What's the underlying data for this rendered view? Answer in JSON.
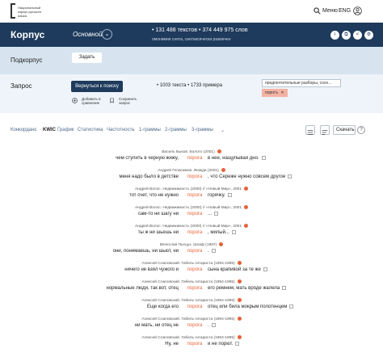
{
  "header": {
    "logo_text": "Национальный корпус русского языка",
    "menu_label": "Меню",
    "lang_label": "ENG"
  },
  "corpus": {
    "title": "Корпус",
    "selected": "Основной",
    "stats": "•  131 488 текстов  •  374 449 975 слов",
    "subtitle": "омонимия снята, синтаксически размечен"
  },
  "subcorpus": {
    "title": "Подкорпус",
    "set_label": "Задать"
  },
  "query": {
    "title": "Запрос",
    "return_label": "Вернуться к поиску",
    "stats": "•  1003 текста  •  1733 примера",
    "add_compare": "Добавить в сравнение",
    "save_query": "Сохранить запрос",
    "tag1": "предпочтительные разборы, сосе...",
    "tag2": "порогъ"
  },
  "tabs": {
    "items": [
      "Конкорданс",
      "KWIC",
      "График",
      "Статистика",
      "Частотность",
      "1-граммы",
      "2-граммы",
      "3-граммы"
    ],
    "active": "KWIC",
    "download_label": "Скачать",
    "help_label": "?"
  },
  "results": [
    {
      "source": "Василь Быков. Болото (2001)",
      "left": "чем ступить в черную жижу,",
      "kw": "порога",
      "right": "в нее, нащупывая дно."
    },
    {
      "source": "Андрей Геласимов. Жажда (2001)",
      "left": "меня надо было в детстве",
      "kw": "порога",
      "right": ", что Сереже нужно совсем другое"
    },
    {
      "source": "Андрей Волос. Недвижимость (2000) // «Новый Мир», 2001",
      "left": "тот счет, что не нужно",
      "kw": "порога",
      "right": "горячку."
    },
    {
      "source": "Андрей Волос. Недвижимость (2000) // «Новый Мир», 2001",
      "left": "сам-то ни шагу ни",
      "kw": "порога",
      "right": "..."
    },
    {
      "source": "Андрей Волос. Недвижимость (2000) // «Новый Мир», 2001",
      "left": "ты ж ни шьешь ни",
      "kw": "порога",
      "right": ", милый..."
    },
    {
      "source": "Вячеслав Пьецух. Шоаф (1997)",
      "left": "они, понимаешь, ни шьют, ни",
      "kw": "порога",
      "right": "."
    },
    {
      "source": "Алексей Слаповский. Гибель гитариста (1994-1995)",
      "left": "ничего не взял чужого и",
      "kw": "порога",
      "right": "сына крапивой за те же"
    },
    {
      "source": "Алексей Слаповский. Гибель гитариста (1994-1995)",
      "left": "нормальные люди, так вот, отец",
      "kw": "порога",
      "right": "его ремнем, мать вроде жалела"
    },
    {
      "source": "Алексей Слаповский. Гибель гитариста (1994-1995)",
      "left": "Еще когда его",
      "kw": "порога",
      "right": "отец или била мокрым полотенцем"
    },
    {
      "source": "Алексей Слаповский. Гибель гитариста (1994-1995)",
      "left": "ни мать, ни отец не",
      "kw": "порога",
      "right": "."
    },
    {
      "source": "Алексей Слаповский. Гибель гитариста (1994-1995)",
      "left": "Ну, не",
      "kw": "порога",
      "right": "и не порют."
    }
  ],
  "colors": {
    "header_bg": "#1e3a5c",
    "subcorpus_bg": "#d7e4ef",
    "query_bg": "#eef4f9",
    "keyword": "#e8643a"
  }
}
